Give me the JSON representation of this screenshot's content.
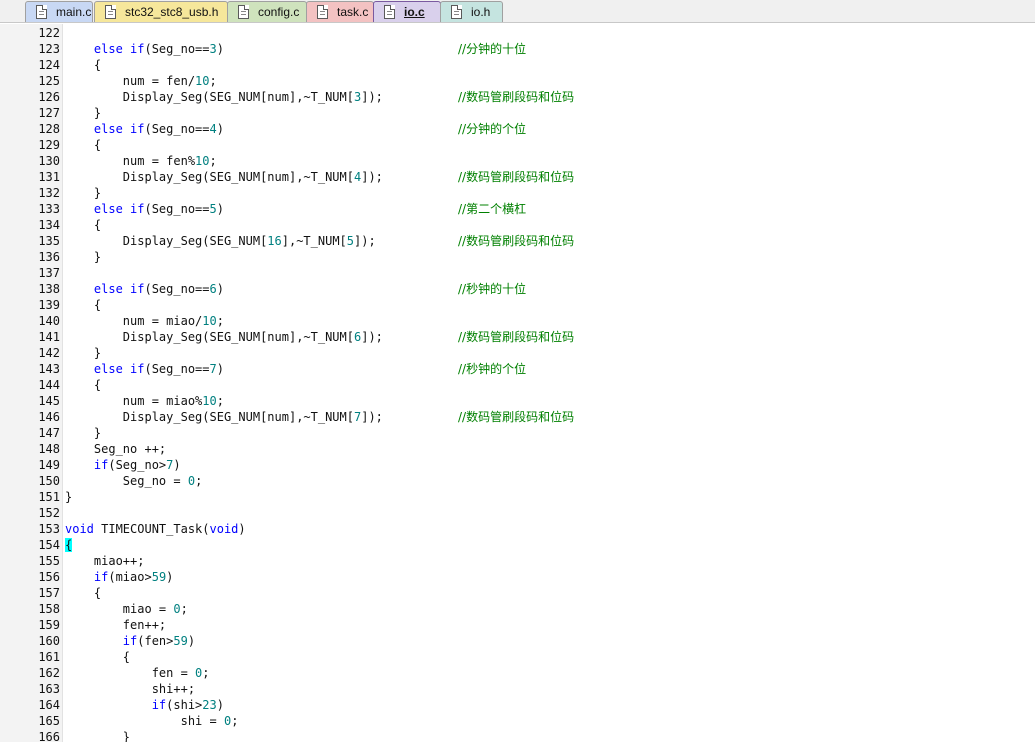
{
  "tabs": [
    {
      "label": "main.c",
      "color": "#c8d8f4",
      "active": false
    },
    {
      "label": "stc32_stc8_usb.h",
      "color": "#f6e79b",
      "active": false
    },
    {
      "label": "config.c",
      "color": "#cfe3bd",
      "active": false
    },
    {
      "label": "task.c",
      "color": "#f3c2c2",
      "active": false
    },
    {
      "label": "io.c",
      "color": "#d9d0ec",
      "active": true
    },
    {
      "label": "io.h",
      "color": "#c5e4e0",
      "active": false
    }
  ],
  "colors": {
    "keyword": "#0000ff",
    "number": "#008080",
    "comment": "#008000",
    "text": "#111111"
  },
  "lines": [
    {
      "n": "122",
      "code": [],
      "comment": ""
    },
    {
      "n": "123",
      "code": [
        [
          "    ",
          ""
        ],
        [
          "else if",
          "kw"
        ],
        [
          "(Seg_no==",
          ""
        ],
        [
          "3",
          "num"
        ],
        [
          ")",
          ""
        ]
      ],
      "comment": "//分钟的十位"
    },
    {
      "n": "124",
      "code": [
        [
          "    {",
          ""
        ]
      ],
      "comment": ""
    },
    {
      "n": "125",
      "code": [
        [
          "        num = fen/",
          ""
        ],
        [
          "10",
          "num"
        ],
        [
          ";",
          ""
        ]
      ],
      "comment": ""
    },
    {
      "n": "126",
      "code": [
        [
          "        Display_Seg(SEG_NUM[num],~T_NUM[",
          ""
        ],
        [
          "3",
          "num"
        ],
        [
          "]);",
          ""
        ]
      ],
      "comment": "//数码管刷段码和位码"
    },
    {
      "n": "127",
      "code": [
        [
          "    }",
          ""
        ]
      ],
      "comment": ""
    },
    {
      "n": "128",
      "code": [
        [
          "    ",
          ""
        ],
        [
          "else if",
          "kw"
        ],
        [
          "(Seg_no==",
          ""
        ],
        [
          "4",
          "num"
        ],
        [
          ")",
          ""
        ]
      ],
      "comment": "//分钟的个位"
    },
    {
      "n": "129",
      "code": [
        [
          "    {",
          ""
        ]
      ],
      "comment": ""
    },
    {
      "n": "130",
      "code": [
        [
          "        num = fen%",
          ""
        ],
        [
          "10",
          "num"
        ],
        [
          ";",
          ""
        ]
      ],
      "comment": ""
    },
    {
      "n": "131",
      "code": [
        [
          "        Display_Seg(SEG_NUM[num],~T_NUM[",
          ""
        ],
        [
          "4",
          "num"
        ],
        [
          "]);",
          ""
        ]
      ],
      "comment": "//数码管刷段码和位码"
    },
    {
      "n": "132",
      "code": [
        [
          "    }",
          ""
        ]
      ],
      "comment": ""
    },
    {
      "n": "133",
      "code": [
        [
          "    ",
          ""
        ],
        [
          "else if",
          "kw"
        ],
        [
          "(Seg_no==",
          ""
        ],
        [
          "5",
          "num"
        ],
        [
          ")",
          ""
        ]
      ],
      "comment": "//第二个横杠"
    },
    {
      "n": "134",
      "code": [
        [
          "    {",
          ""
        ]
      ],
      "comment": ""
    },
    {
      "n": "135",
      "code": [
        [
          "        Display_Seg(SEG_NUM[",
          ""
        ],
        [
          "16",
          "num"
        ],
        [
          "],~T_NUM[",
          ""
        ],
        [
          "5",
          "num"
        ],
        [
          "]);",
          ""
        ]
      ],
      "comment": "//数码管刷段码和位码"
    },
    {
      "n": "136",
      "code": [
        [
          "    }",
          ""
        ]
      ],
      "comment": ""
    },
    {
      "n": "137",
      "code": [],
      "comment": ""
    },
    {
      "n": "138",
      "code": [
        [
          "    ",
          ""
        ],
        [
          "else if",
          "kw"
        ],
        [
          "(Seg_no==",
          ""
        ],
        [
          "6",
          "num"
        ],
        [
          ")",
          ""
        ]
      ],
      "comment": "//秒钟的十位"
    },
    {
      "n": "139",
      "code": [
        [
          "    {",
          ""
        ]
      ],
      "comment": ""
    },
    {
      "n": "140",
      "code": [
        [
          "        num = miao/",
          ""
        ],
        [
          "10",
          "num"
        ],
        [
          ";",
          ""
        ]
      ],
      "comment": ""
    },
    {
      "n": "141",
      "code": [
        [
          "        Display_Seg(SEG_NUM[num],~T_NUM[",
          ""
        ],
        [
          "6",
          "num"
        ],
        [
          "]);",
          ""
        ]
      ],
      "comment": "//数码管刷段码和位码"
    },
    {
      "n": "142",
      "code": [
        [
          "    }",
          ""
        ]
      ],
      "comment": ""
    },
    {
      "n": "143",
      "code": [
        [
          "    ",
          ""
        ],
        [
          "else if",
          "kw"
        ],
        [
          "(Seg_no==",
          ""
        ],
        [
          "7",
          "num"
        ],
        [
          ")",
          ""
        ]
      ],
      "comment": "//秒钟的个位"
    },
    {
      "n": "144",
      "code": [
        [
          "    {",
          ""
        ]
      ],
      "comment": ""
    },
    {
      "n": "145",
      "code": [
        [
          "        num = miao%",
          ""
        ],
        [
          "10",
          "num"
        ],
        [
          ";",
          ""
        ]
      ],
      "comment": ""
    },
    {
      "n": "146",
      "code": [
        [
          "        Display_Seg(SEG_NUM[num],~T_NUM[",
          ""
        ],
        [
          "7",
          "num"
        ],
        [
          "]);",
          ""
        ]
      ],
      "comment": "//数码管刷段码和位码"
    },
    {
      "n": "147",
      "code": [
        [
          "    }",
          ""
        ]
      ],
      "comment": ""
    },
    {
      "n": "148",
      "code": [
        [
          "    Seg_no ++;",
          ""
        ]
      ],
      "comment": ""
    },
    {
      "n": "149",
      "code": [
        [
          "    ",
          ""
        ],
        [
          "if",
          "kw"
        ],
        [
          "(Seg_no>",
          ""
        ],
        [
          "7",
          "num"
        ],
        [
          ")",
          ""
        ]
      ],
      "comment": ""
    },
    {
      "n": "150",
      "code": [
        [
          "        Seg_no = ",
          ""
        ],
        [
          "0",
          "num"
        ],
        [
          ";",
          ""
        ]
      ],
      "comment": ""
    },
    {
      "n": "151",
      "code": [
        [
          "}",
          ""
        ]
      ],
      "comment": ""
    },
    {
      "n": "152",
      "code": [],
      "comment": ""
    },
    {
      "n": "153",
      "code": [
        [
          "void",
          "kw"
        ],
        [
          " TIMECOUNT_Task(",
          ""
        ],
        [
          "void",
          "kw"
        ],
        [
          ")",
          ""
        ]
      ],
      "comment": ""
    },
    {
      "n": "154",
      "code": [
        [
          "{",
          "brace-hl"
        ]
      ],
      "comment": ""
    },
    {
      "n": "155",
      "code": [
        [
          "    miao++;",
          ""
        ]
      ],
      "comment": ""
    },
    {
      "n": "156",
      "code": [
        [
          "    ",
          ""
        ],
        [
          "if",
          "kw"
        ],
        [
          "(miao>",
          ""
        ],
        [
          "59",
          "num"
        ],
        [
          ")",
          ""
        ]
      ],
      "comment": ""
    },
    {
      "n": "157",
      "code": [
        [
          "    {",
          ""
        ]
      ],
      "comment": ""
    },
    {
      "n": "158",
      "code": [
        [
          "        miao = ",
          ""
        ],
        [
          "0",
          "num"
        ],
        [
          ";",
          ""
        ]
      ],
      "comment": ""
    },
    {
      "n": "159",
      "code": [
        [
          "        fen++;",
          ""
        ]
      ],
      "comment": ""
    },
    {
      "n": "160",
      "code": [
        [
          "        ",
          ""
        ],
        [
          "if",
          "kw"
        ],
        [
          "(fen>",
          ""
        ],
        [
          "59",
          "num"
        ],
        [
          ")",
          ""
        ]
      ],
      "comment": ""
    },
    {
      "n": "161",
      "code": [
        [
          "        {",
          ""
        ]
      ],
      "comment": ""
    },
    {
      "n": "162",
      "code": [
        [
          "            fen = ",
          ""
        ],
        [
          "0",
          "num"
        ],
        [
          ";",
          ""
        ]
      ],
      "comment": ""
    },
    {
      "n": "163",
      "code": [
        [
          "            shi++;",
          ""
        ]
      ],
      "comment": ""
    },
    {
      "n": "164",
      "code": [
        [
          "            ",
          ""
        ],
        [
          "if",
          "kw"
        ],
        [
          "(shi>",
          ""
        ],
        [
          "23",
          "num"
        ],
        [
          ")",
          ""
        ]
      ],
      "comment": ""
    },
    {
      "n": "165",
      "code": [
        [
          "                shi = ",
          ""
        ],
        [
          "0",
          "num"
        ],
        [
          ";",
          ""
        ]
      ],
      "comment": ""
    },
    {
      "n": "166",
      "code": [
        [
          "        }",
          ""
        ]
      ],
      "comment": ""
    }
  ]
}
